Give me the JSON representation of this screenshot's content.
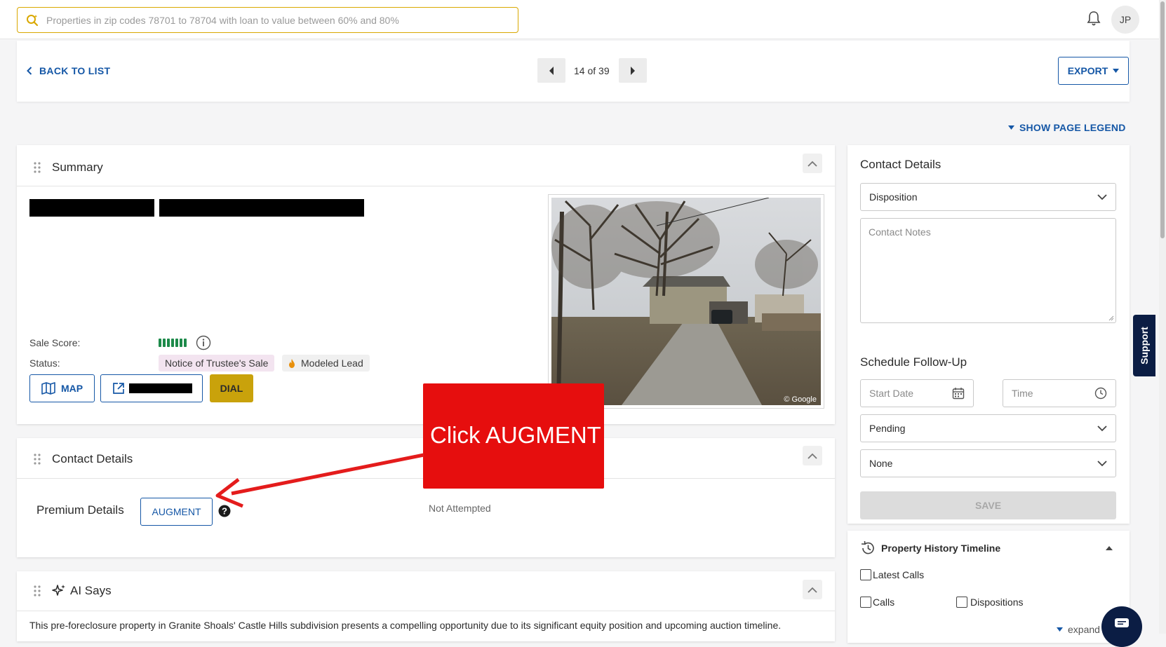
{
  "search": {
    "placeholder": "Properties in zip codes 78701 to 78704 with loan to value between 60% and 80%"
  },
  "user": {
    "initials": "JP"
  },
  "nav": {
    "back_label": "BACK TO LIST",
    "page_count": "14 of 39",
    "export_label": "EXPORT",
    "legend_label": "SHOW PAGE LEGEND"
  },
  "summary": {
    "title": "Summary",
    "sale_score_label": "Sale Score:",
    "sale_score_bars": 7,
    "status_label": "Status:",
    "status_badge": "Notice of Trustee's Sale",
    "lead_badge": "Modeled Lead",
    "map_label": "MAP",
    "dial_label": "DIAL",
    "photo_credit": "© Google"
  },
  "contact_card": {
    "title": "Contact Details",
    "premium_label": "Premium Details",
    "augment_label": "AUGMENT",
    "attempt_status": "Not Attempted"
  },
  "annotation": {
    "callout_text": "Click AUGMENT"
  },
  "ai": {
    "title": "AI Says",
    "text": "This pre-foreclosure property in Granite Shoals' Castle Hills subdivision presents a compelling opportunity due to its significant equity position and upcoming auction timeline."
  },
  "side": {
    "title": "Contact Details",
    "disposition_placeholder": "Disposition",
    "notes_placeholder": "Contact Notes",
    "followup_title": "Schedule Follow-Up",
    "start_date_placeholder": "Start Date",
    "time_placeholder": "Time",
    "status_select": "Pending",
    "second_select": "None",
    "save_label": "SAVE",
    "history_title": "Property History Timeline",
    "latest_calls_label": "Latest Calls",
    "calls_label": "Calls",
    "dispositions_label": "Dispositions",
    "expand_label": "expand"
  },
  "support_label": "Support",
  "colors": {
    "accent": "#1557a6",
    "gold": "#d9a800",
    "dial": "#c9a20b",
    "callout": "#e60e0e",
    "score_green": "#1d8a4a"
  }
}
